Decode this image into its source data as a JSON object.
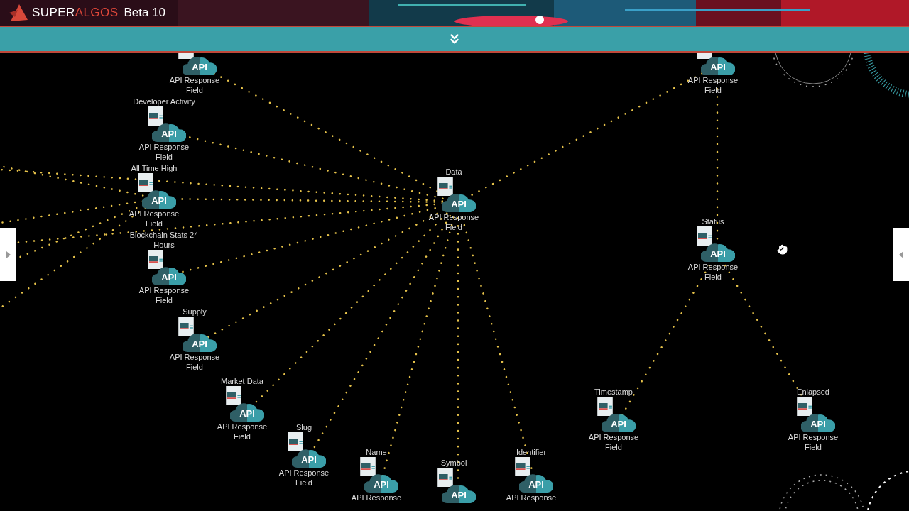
{
  "header": {
    "brand_first": "SUPER",
    "brand_second": "ALGOS",
    "version": "Beta 10"
  },
  "canvas": {
    "nodes": [
      {
        "title": "Data",
        "icon_text": "API",
        "label": "API Response Field",
        "children": [
          {
            "icon_text": "API",
            "label": "API Response Field"
          },
          {
            "title": "Developer Activity",
            "icon_text": "API",
            "label": "API Response Field"
          },
          {
            "title": "All Time High",
            "icon_text": "API",
            "label": "API Response Field"
          },
          {
            "title": "Blockchain Stats 24 Hours",
            "icon_text": "API",
            "label": "API Response Field"
          },
          {
            "title": "Supply",
            "icon_text": "API",
            "label": "API Response Field"
          },
          {
            "title": "Market Data",
            "icon_text": "API",
            "label": "API Response Field"
          },
          {
            "title": "Slug",
            "icon_text": "API",
            "label": "API Response Field"
          },
          {
            "title": "Name",
            "icon_text": "API",
            "label": "API Response"
          },
          {
            "title": "Symbol",
            "icon_text": "API"
          },
          {
            "title": "Identifier",
            "icon_text": "API",
            "label": "API Response"
          },
          {
            "icon_text": "API",
            "label": "API Response Field",
            "children": [
              {
                "title": "Status",
                "icon_text": "API",
                "label": "API Response Field",
                "children": [
                  {
                    "title": "Timestamp",
                    "icon_text": "API",
                    "label": "API Response Field"
                  },
                  {
                    "title": "Enlapsed",
                    "icon_text": "API",
                    "label": "API Response Field"
                  }
                ]
              }
            ]
          }
        ]
      }
    ]
  }
}
